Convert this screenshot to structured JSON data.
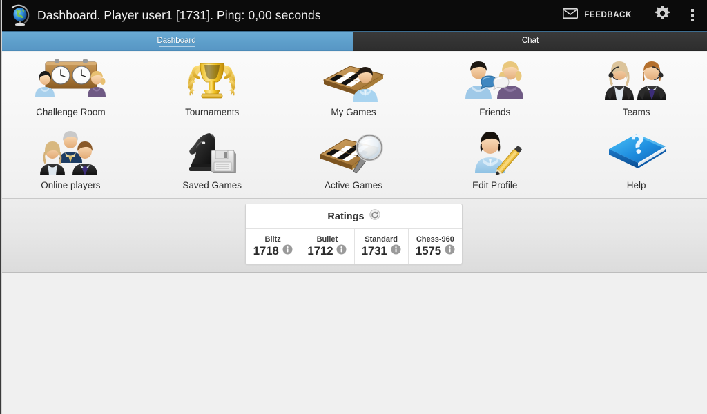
{
  "titlebar": {
    "app_icon": "globe-icon",
    "title": "Dashboard. Player user1 [1731]. Ping: 0,00 seconds",
    "feedback_label": "FEEDBACK",
    "feedback_icon": "envelope-icon",
    "settings_icon": "gear-icon",
    "overflow_icon": "overflow-menu-icon",
    "background": "#0b0b0b"
  },
  "tabs": {
    "active_index": 0,
    "active_color": "#5e9fcb",
    "inactive_color": "#333333",
    "items": [
      {
        "label": "Dashboard"
      },
      {
        "label": "Chat"
      }
    ]
  },
  "dashboard": {
    "rows": [
      [
        {
          "label": "Challenge Room",
          "icon": "chess-clock-players-icon"
        },
        {
          "label": "Tournaments",
          "icon": "trophy-icon"
        },
        {
          "label": "My Games",
          "icon": "chessboard-player-icon"
        },
        {
          "label": "Friends",
          "icon": "two-people-chat-icon"
        },
        {
          "label": "Teams",
          "icon": "two-business-people-icon"
        }
      ],
      [
        {
          "label": "Online players",
          "icon": "three-people-group-icon"
        },
        {
          "label": "Saved Games",
          "icon": "knight-floppy-disk-icon"
        },
        {
          "label": "Active Games",
          "icon": "chessboard-magnifier-icon"
        },
        {
          "label": "Edit Profile",
          "icon": "person-pencil-icon"
        },
        {
          "label": "Help",
          "icon": "blue-book-question-icon"
        }
      ]
    ]
  },
  "ratings": {
    "title": "Ratings",
    "refresh_icon": "refresh-icon",
    "info_icon": "info-icon",
    "columns": [
      {
        "name": "Blitz",
        "value": "1718"
      },
      {
        "name": "Bullet",
        "value": "1712"
      },
      {
        "name": "Standard",
        "value": "1731"
      },
      {
        "name": "Chess-960",
        "value": "1575"
      }
    ]
  }
}
